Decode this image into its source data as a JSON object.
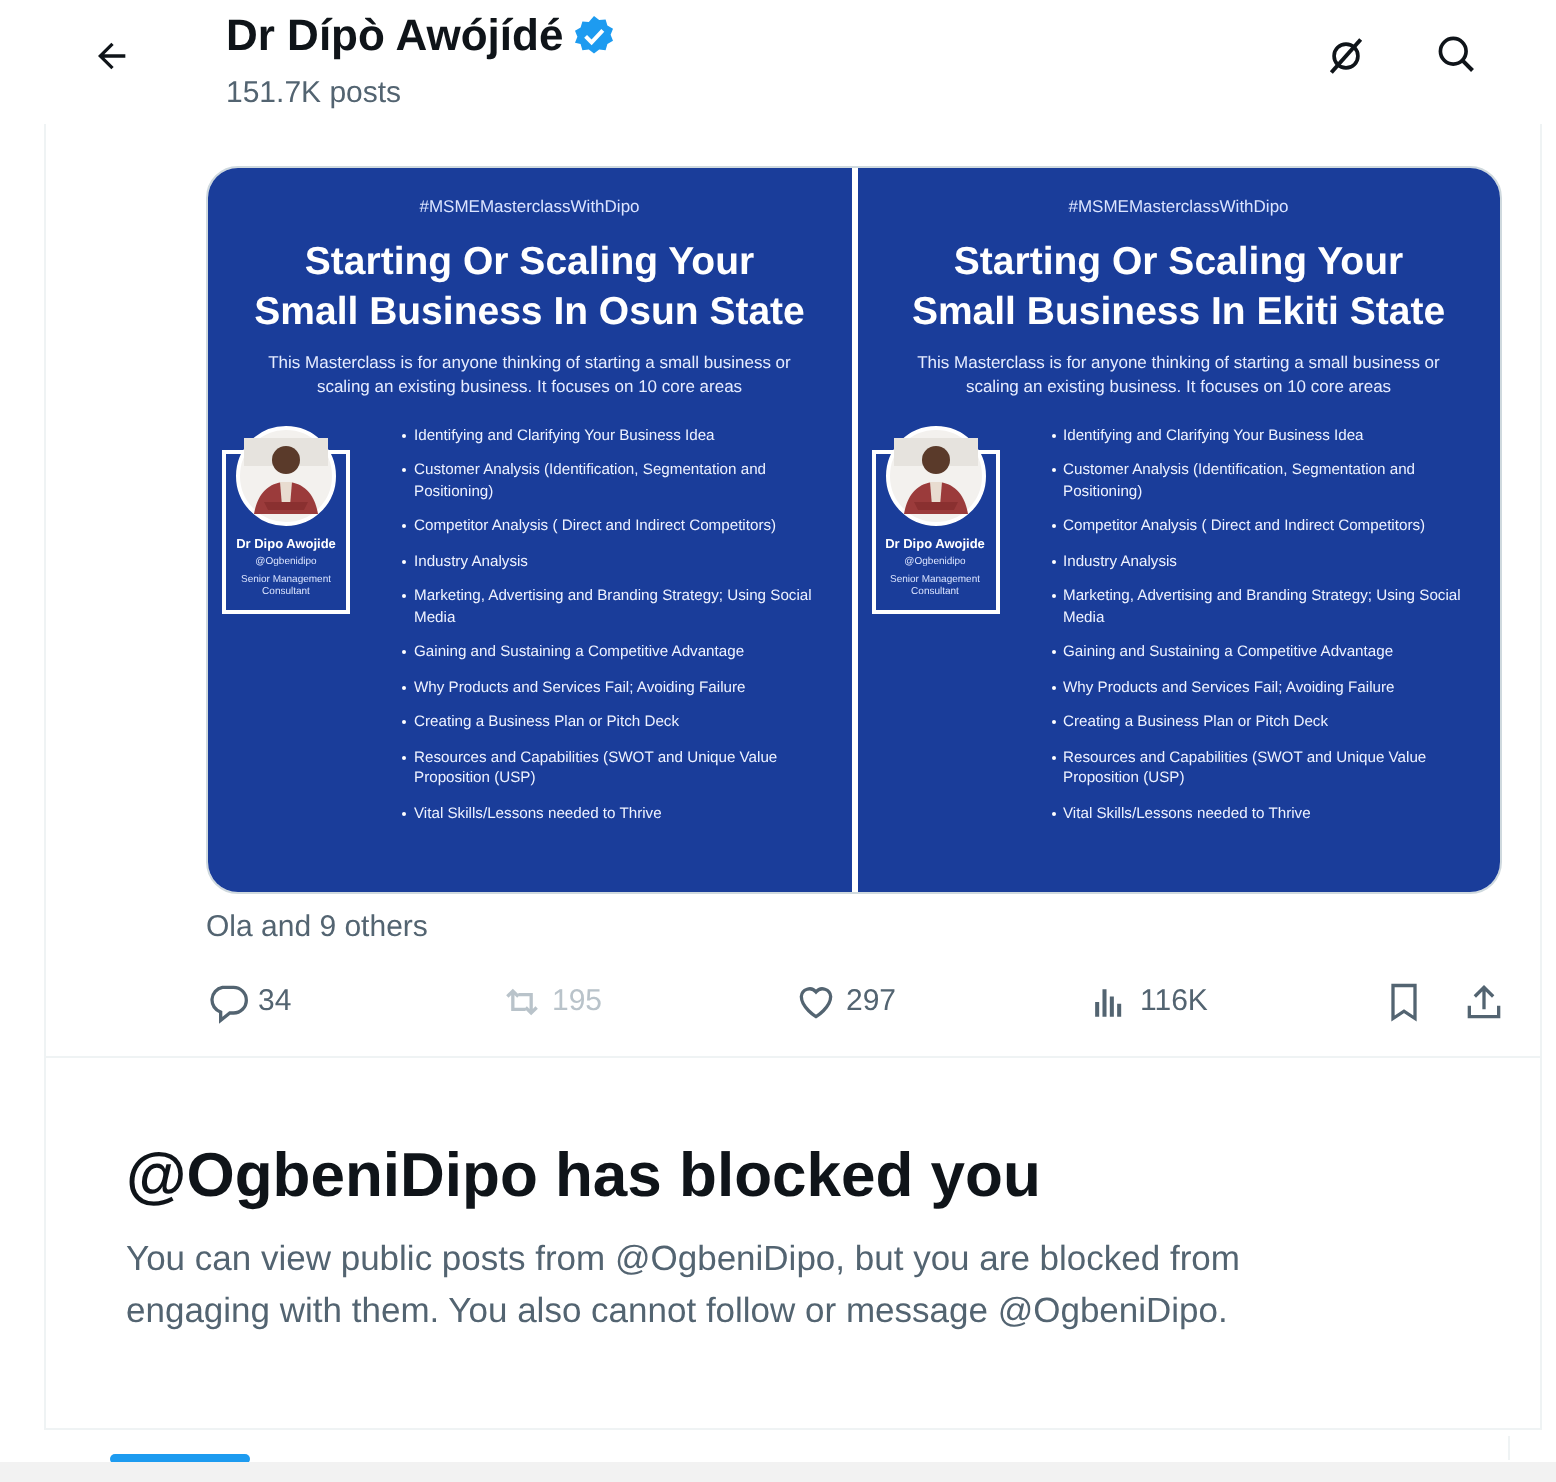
{
  "header": {
    "name": "Dr Dípò Awójídé",
    "verified": true,
    "posts": "151.7K posts"
  },
  "post": {
    "images": [
      {
        "hashtag": "#MSMEMasterclassWithDipo",
        "title": [
          "Starting Or Scaling Your",
          "Small Business In Osun State"
        ],
        "subtitle": "This Masterclass is for anyone thinking of starting a small business or scaling an existing business. It focuses on 10 core areas",
        "profile": {
          "name": "Dr Dipo Awojide",
          "handle": "@Ogbenidipo",
          "role": "Senior Management Consultant"
        },
        "bullets": [
          "Identifying and Clarifying Your Business Idea",
          "Customer Analysis (Identification, Segmentation and Positioning)",
          "Competitor Analysis ( Direct and Indirect Competitors)",
          "Industry Analysis",
          "Marketing, Advertising and Branding Strategy; Using Social Media",
          "Gaining and Sustaining a Competitive Advantage",
          "Why Products and Services Fail; Avoiding Failure",
          "Creating a Business Plan or Pitch Deck",
          "Resources and Capabilities (SWOT and Unique Value Proposition (USP)",
          "Vital Skills/Lessons needed to Thrive"
        ]
      },
      {
        "hashtag": "#MSMEMasterclassWithDipo",
        "title": [
          "Starting Or Scaling Your",
          "Small Business In Ekiti State"
        ],
        "subtitle": "This Masterclass is for anyone thinking of starting a small business or scaling an existing business. It focuses on 10 core areas",
        "profile": {
          "name": "Dr Dipo Awojide",
          "handle": "@Ogbenidipo",
          "role": "Senior Management Consultant"
        },
        "bullets": [
          "Identifying and Clarifying Your Business Idea",
          "Customer Analysis (Identification, Segmentation and Positioning)",
          "Competitor Analysis ( Direct and Indirect Competitors)",
          "Industry Analysis",
          "Marketing, Advertising and Branding Strategy; Using Social Media",
          "Gaining and Sustaining a Competitive Advantage",
          "Why Products and Services Fail; Avoiding Failure",
          "Creating a Business Plan or Pitch Deck",
          "Resources and Capabilities (SWOT and Unique Value Proposition (USP)",
          "Vital Skills/Lessons needed to Thrive"
        ]
      }
    ],
    "liked_by": "Ola and 9 others",
    "actions": [
      {
        "kind": "reply",
        "count": "34",
        "disabled": false
      },
      {
        "kind": "repost",
        "count": "195",
        "disabled": true
      },
      {
        "kind": "like",
        "count": "297",
        "disabled": false
      },
      {
        "kind": "views",
        "count": "116K",
        "disabled": false
      },
      {
        "kind": "bookmark",
        "disabled": false
      },
      {
        "kind": "share",
        "disabled": false
      }
    ]
  },
  "blocked": {
    "title": "@OgbeniDipo has blocked you",
    "body": "You can view public posts from @OgbeniDipo, but you are blocked from engaging with them. You also cannot follow or message @OgbeniDipo."
  }
}
